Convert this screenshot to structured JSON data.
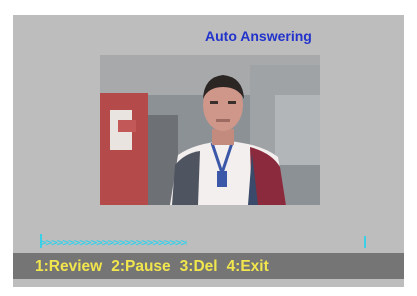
{
  "header": {
    "title": "Auto Answering"
  },
  "video": {
    "icon": "caller-photo"
  },
  "playback": {
    "progress_percent": 45,
    "fill_glyphs": ">>>>>>>>>>>>>>>>>>>>>>>>>>>>>>>>"
  },
  "menu": {
    "items": [
      {
        "label": "1:Review"
      },
      {
        "label": "2:Pause"
      },
      {
        "label": "3:Del"
      },
      {
        "label": "4:Exit"
      }
    ]
  },
  "colors": {
    "panel": "#bdbdbd",
    "title": "#2233cc",
    "menu_bar": "#757575",
    "menu_text": "#f2e64d",
    "progress": "#3ad0e8"
  }
}
